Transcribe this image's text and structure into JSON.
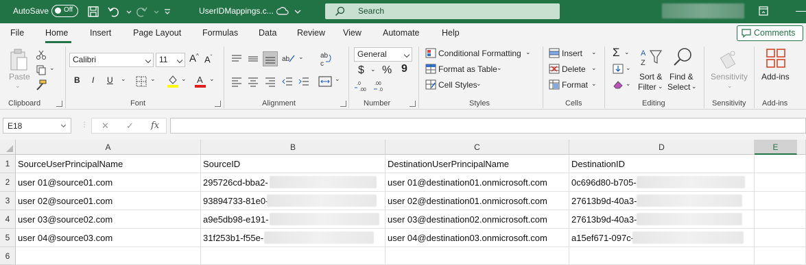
{
  "titlebar": {
    "autosave_label": "AutoSave",
    "autosave_state": "Off",
    "filename": "UserIDMappings.c...",
    "search_placeholder": "Search",
    "accent_color": "#217346"
  },
  "menu": {
    "tabs": [
      "File",
      "Home",
      "Insert",
      "Page Layout",
      "Formulas",
      "Data",
      "Review",
      "View",
      "Automate",
      "Help"
    ],
    "active_tab": "Home",
    "comments_label": "Comments"
  },
  "ribbon": {
    "clipboard": {
      "paste": "Paste",
      "label": "Clipboard"
    },
    "font": {
      "family": "Calibri",
      "size": "11",
      "label": "Font",
      "bold": "B",
      "italic": "I",
      "underline": "U"
    },
    "alignment": {
      "label": "Alignment"
    },
    "number": {
      "format": "General",
      "label": "Number",
      "currency": "$",
      "percent": "%",
      "comma": "9"
    },
    "styles": {
      "conditional": "Conditional Formatting",
      "format_table": "Format as Table",
      "cell_styles": "Cell Styles",
      "label": "Styles"
    },
    "cells": {
      "insert": "Insert",
      "delete": "Delete",
      "format": "Format",
      "label": "Cells"
    },
    "editing": {
      "sort_filter_1": "Sort &",
      "sort_filter_2": "Filter",
      "find_select_1": "Find &",
      "find_select_2": "Select",
      "label": "Editing"
    },
    "sensitivity": {
      "button": "Sensitivity",
      "label": "Sensitivity"
    },
    "addins": {
      "button": "Add-ins",
      "label": "Add-ins"
    }
  },
  "formula_bar": {
    "name_box": "E18",
    "formula": "",
    "fx": "fx"
  },
  "sheet": {
    "columns": [
      "A",
      "B",
      "C",
      "D",
      "E"
    ],
    "selected_column": "E",
    "row_numbers": [
      "1",
      "2",
      "3",
      "4",
      "5",
      "6"
    ],
    "rows": [
      [
        "SourceUserPrincipalName",
        "SourceID",
        "DestinationUserPrincipalName",
        "DestinationID",
        ""
      ],
      [
        "user 01@source01.com",
        "295726cd-bba2-",
        "user 01@destination01.onmicrosoft.com",
        "0c696d80-b705-",
        ""
      ],
      [
        "user 02@source01.com",
        "93894733-81e0-",
        "user 02@destination01.onmicrosoft.com",
        "27613b9d-40a3-",
        ""
      ],
      [
        "user 03@source02.com",
        "a9e5db98-e191-",
        "user 03@destination02.onmicrosoft.com",
        "27613b9d-40a3-",
        ""
      ],
      [
        "user 04@source03.com",
        "31f253b1-f55e-",
        "user 04@destination03.onmicrosoft.com",
        "a15ef671-097c-",
        ""
      ],
      [
        "",
        "",
        "",
        "",
        ""
      ]
    ]
  }
}
